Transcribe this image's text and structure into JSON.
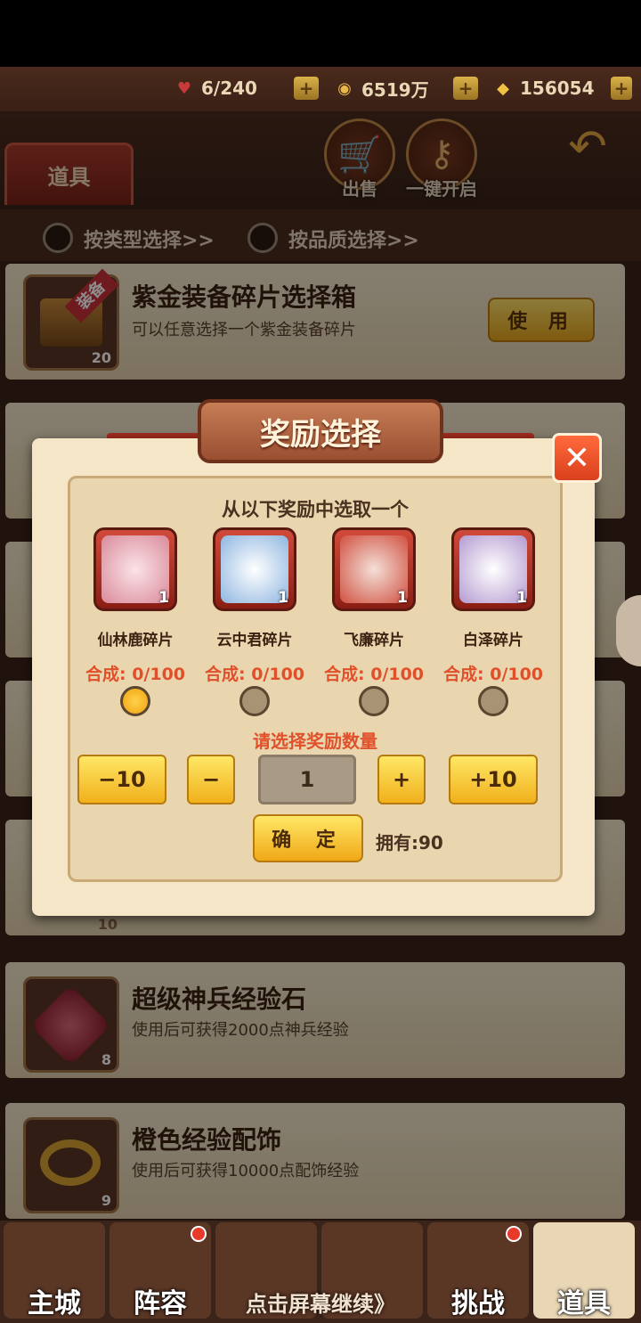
{
  "resources": {
    "stamina": "6/240",
    "coins": "6519万",
    "ingots": "156054",
    "plus": "+"
  },
  "header": {
    "tab_label": "道具",
    "sell_label": "出售",
    "open_all_label": "一键开启"
  },
  "filters": {
    "by_type": "按类型选择>>",
    "by_quality": "按品质选择>>"
  },
  "items": [
    {
      "title": "紫金装备碎片选择箱",
      "desc": "可以任意选择一个紫金装备碎片",
      "count": "20",
      "badge": "装备",
      "button": "使 用"
    },
    {
      "title": "超级神兵经验石",
      "desc": "使用后可获得2000点神兵经验",
      "count": "8"
    },
    {
      "title": "橙色经验配饰",
      "desc": "使用后可获得10000点配饰经验",
      "count": "9"
    }
  ],
  "hidden_count": "10",
  "modal": {
    "title": "奖励选择",
    "close": "✕",
    "subtitle": "从以下奖励中选取一个",
    "rewards": [
      {
        "name": "仙林鹿碎片",
        "qty": "1",
        "synth_label": "合成:",
        "synth_value": "0/100",
        "selected": true
      },
      {
        "name": "云中君碎片",
        "qty": "1",
        "synth_label": "合成:",
        "synth_value": "0/100",
        "selected": false
      },
      {
        "name": "飞廉碎片",
        "qty": "1",
        "synth_label": "合成:",
        "synth_value": "0/100",
        "selected": false
      },
      {
        "name": "白泽碎片",
        "qty": "1",
        "synth_label": "合成:",
        "synth_value": "0/100",
        "selected": false
      }
    ],
    "quantity_title": "请选择奖励数量",
    "minus10": "−10",
    "minus": "−",
    "quantity": "1",
    "plus": "+",
    "plus10": "+10",
    "confirm": "确 定",
    "owned": "拥有:90"
  },
  "bottom_nav": [
    {
      "label": "主城",
      "dot": false
    },
    {
      "label": "阵容",
      "dot": true
    },
    {
      "label": "",
      "dot": false
    },
    {
      "label": "",
      "dot": false
    },
    {
      "label": "挑战",
      "dot": true
    },
    {
      "label": "道具",
      "dot": false
    }
  ],
  "continue_hint": "点击屏幕继续》"
}
